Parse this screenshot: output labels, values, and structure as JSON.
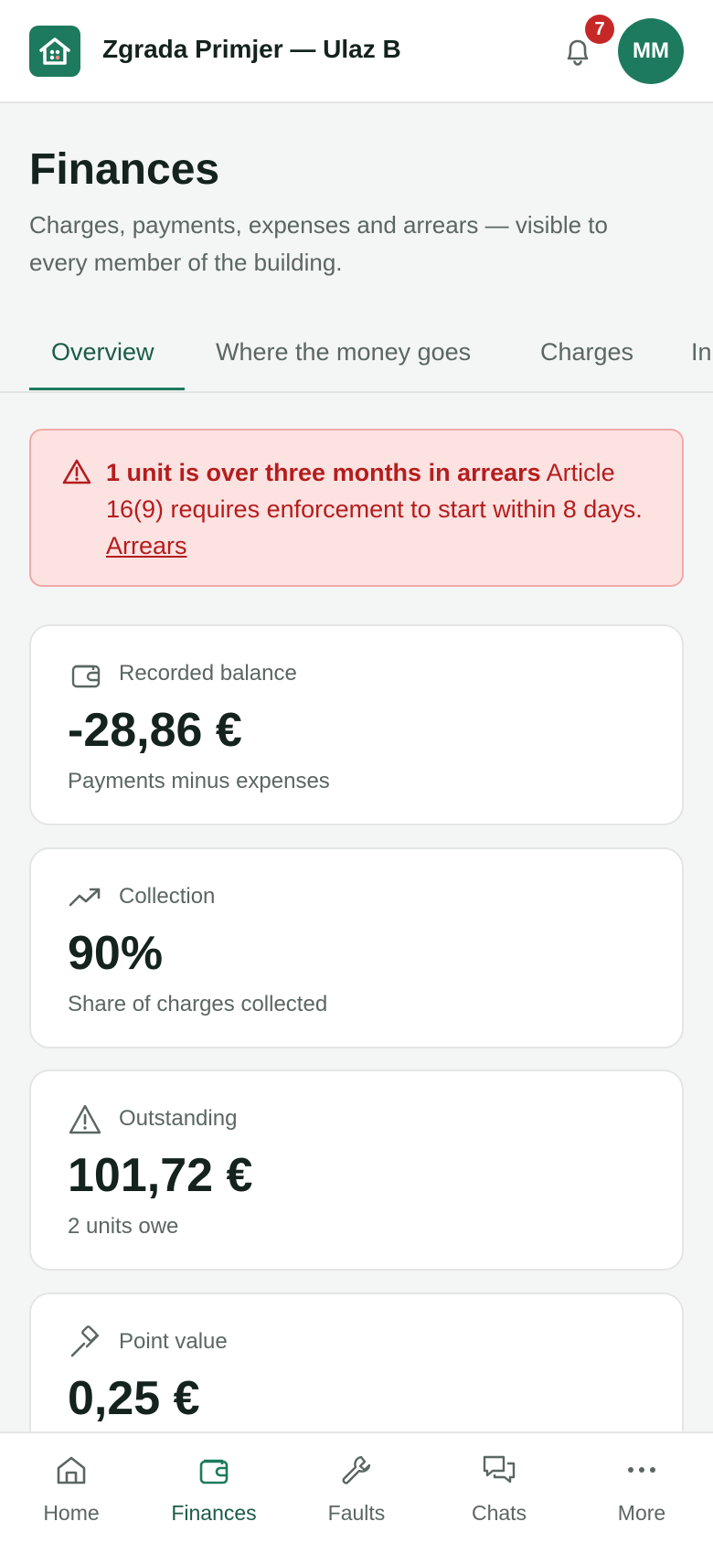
{
  "header": {
    "building_name": "Zgrada Primjer — Ulaz B",
    "notification_count": "7",
    "avatar_initials": "MM"
  },
  "page": {
    "title": "Finances",
    "subtitle": "Charges, payments, expenses and arrears — visible to every member of the building."
  },
  "tabs": [
    {
      "label": "Overview",
      "active": true
    },
    {
      "label": "Where the money goes",
      "active": false
    },
    {
      "label": "Charges",
      "active": false
    },
    {
      "label": "In",
      "active": false
    }
  ],
  "alert": {
    "bold": "1 unit is over three months in arrears",
    "text": " Article 16(9) requires enforcement to start within 8 days. ",
    "link": "Arrears"
  },
  "cards": [
    {
      "icon": "wallet-icon",
      "label": "Recorded balance",
      "value": "-28,86 €",
      "note": "Payments minus expenses"
    },
    {
      "icon": "trending-up-icon",
      "label": "Collection",
      "value": "90%",
      "note": "Share of charges collected"
    },
    {
      "icon": "warning-icon",
      "label": "Outstanding",
      "value": "101,72 €",
      "note": "2 units owe"
    },
    {
      "icon": "gavel-icon",
      "label": "Point value",
      "value": "0,25 €",
      "note": ""
    }
  ],
  "bottom_nav": [
    {
      "icon": "home-icon",
      "label": "Home",
      "active": false
    },
    {
      "icon": "wallet-icon",
      "label": "Finances",
      "active": true
    },
    {
      "icon": "wrench-icon",
      "label": "Faults",
      "active": false
    },
    {
      "icon": "chat-icon",
      "label": "Chats",
      "active": false
    },
    {
      "icon": "more-icon",
      "label": "More",
      "active": false
    }
  ],
  "colors": {
    "brand": "#1e7a5e",
    "alert_bg": "#fde2e2",
    "alert_text": "#b51d1d",
    "badge": "#c62828"
  }
}
